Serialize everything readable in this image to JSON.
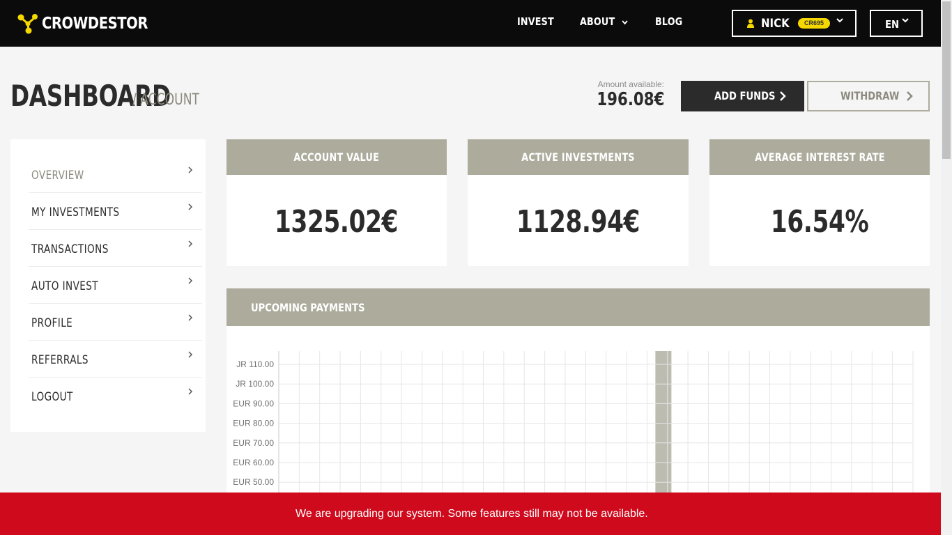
{
  "brand": {
    "name": "CROWDESTOR",
    "accent": "#f5d800"
  },
  "nav": {
    "items": [
      "INVEST",
      "ABOUT",
      "BLOG"
    ],
    "user": {
      "name": "NICK",
      "badge": "CR695"
    },
    "language": "EN"
  },
  "page": {
    "title": "DASHBOARD",
    "subtitle": "/ ACCOUNT",
    "amount_label": "Amount available:",
    "amount_value": "196.08€",
    "add_funds_label": "ADD FUNDS",
    "withdraw_label": "WITHDRAW"
  },
  "sidebar": {
    "items": [
      {
        "label": "OVERVIEW",
        "active": true
      },
      {
        "label": "MY INVESTMENTS"
      },
      {
        "label": "TRANSACTIONS"
      },
      {
        "label": "AUTO INVEST"
      },
      {
        "label": "PROFILE"
      },
      {
        "label": "REFERRALS"
      },
      {
        "label": "LOGOUT"
      }
    ]
  },
  "cards": [
    {
      "title": "ACCOUNT VALUE",
      "value": "1325.02€"
    },
    {
      "title": "ACTIVE INVESTMENTS",
      "value": "1128.94€"
    },
    {
      "title": "AVERAGE INTEREST RATE",
      "value": "16.54%"
    }
  ],
  "chart_panel": {
    "title": "UPCOMING PAYMENTS"
  },
  "chart_data": {
    "type": "bar",
    "title": "UPCOMING PAYMENTS",
    "y_tick_labels": [
      "JR 110.00",
      "JR 100.00",
      "EUR 90.00",
      "EUR 80.00",
      "EUR 70.00",
      "EUR 60.00",
      "EUR 50.00"
    ],
    "ylim": [
      0,
      110
    ],
    "grid": true,
    "highlight_column": 18,
    "column_count": 31,
    "bar_color": "#bdbcb0"
  },
  "banner": {
    "text": "We are upgrading our system. Some features still may not be available.",
    "color": "#cf0a1c"
  }
}
